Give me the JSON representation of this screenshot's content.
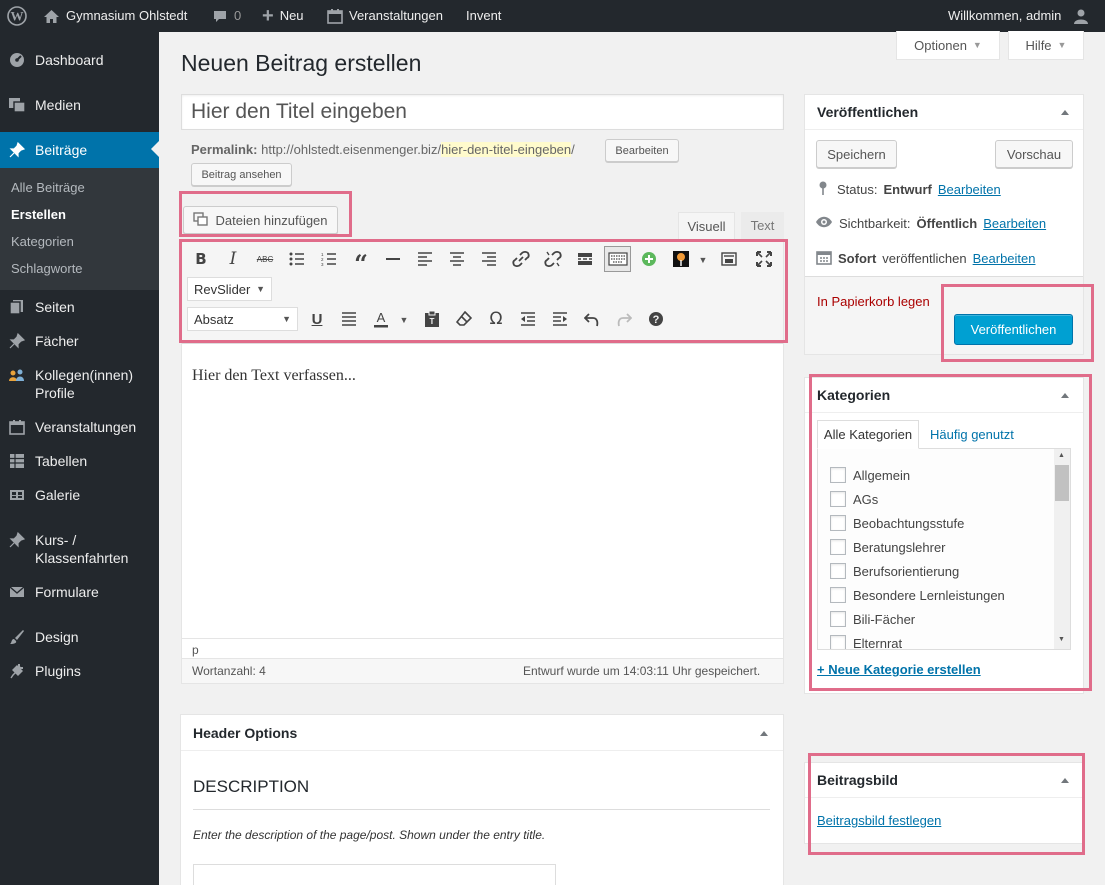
{
  "adminbar": {
    "site_name": "Gymnasium Ohlstedt",
    "comments_count": "0",
    "new_label": "Neu",
    "events_label": "Veranstaltungen",
    "invent_label": "Invent",
    "welcome": "Willkommen, admin"
  },
  "sidebar": {
    "items": [
      {
        "label": "Dashboard",
        "icon": "dashboard-icon"
      },
      {
        "label": "Medien",
        "icon": "media-icon"
      },
      {
        "label": "Beiträge",
        "icon": "pin-icon"
      },
      {
        "label": "Seiten",
        "icon": "pages-icon"
      },
      {
        "label": "Fächer",
        "icon": "pin-icon"
      },
      {
        "label": "Kollegen(innen)",
        "label2": "Profile",
        "icon": "people-icon"
      },
      {
        "label": "Veranstaltungen",
        "icon": "calendar-icon"
      },
      {
        "label": "Tabellen",
        "icon": "table-icon"
      },
      {
        "label": "Galerie",
        "icon": "gallery-icon"
      },
      {
        "label": "Kurs- /",
        "label2": "Klassenfahrten",
        "icon": "pin-icon"
      },
      {
        "label": "Formulare",
        "icon": "mail-icon"
      },
      {
        "label": "Design",
        "icon": "brush-icon"
      },
      {
        "label": "Plugins",
        "icon": "plug-icon"
      }
    ],
    "submenu": [
      "Alle Beiträge",
      "Erstellen",
      "Kategorien",
      "Schlagworte"
    ]
  },
  "screen_options": {
    "optionen": "Optionen",
    "hilfe": "Hilfe"
  },
  "page_title": "Neuen Beitrag erstellen",
  "title_input": {
    "placeholder": "Hier den Titel eingeben"
  },
  "permalink": {
    "label": "Permalink:",
    "base": "http://ohlstedt.eisenmenger.biz/",
    "slug": "hier-den-titel-eingeben",
    "trail": "/",
    "edit_button": "Bearbeiten",
    "view_button": "Beitrag ansehen"
  },
  "editor": {
    "add_media": "Dateien hinzufügen",
    "tab_visual": "Visuell",
    "tab_text": "Text",
    "revslider": "RevSlider",
    "format_select": "Absatz",
    "body_text": "Hier den Text verfassen...",
    "path": "p",
    "word_count": "Wortanzahl: 4",
    "saved_status": "Entwurf wurde um 14:03:11 Uhr gespeichert."
  },
  "header_options": {
    "title": "Header Options",
    "section": "DESCRIPTION",
    "help": "Enter the description of the page/post. Shown under the entry title."
  },
  "publish": {
    "title": "Veröffentlichen",
    "save_draft": "Speichern",
    "preview": "Vorschau",
    "status_label": "Status:",
    "status_value": "Entwurf",
    "visibility_label": "Sichtbarkeit:",
    "visibility_value": "Öffentlich",
    "schedule_label": "Sofort",
    "schedule_text": "veröffentlichen",
    "edit_link": "Bearbeiten",
    "trash": "In Papierkorb legen",
    "publish_button": "Veröffentlichen"
  },
  "categories": {
    "title": "Kategorien",
    "tab_all": "Alle Kategorien",
    "tab_popular": "Häufig genutzt",
    "items": [
      "Allgemein",
      "AGs",
      "Beobachtungsstufe",
      "Beratungslehrer",
      "Berufsorientierung",
      "Besondere Lernleistungen",
      "Bili-Fächer",
      "Elternrat"
    ],
    "add_new": "+ Neue Kategorie erstellen"
  },
  "featured_image": {
    "title": "Beitragsbild",
    "set_link": "Beitragsbild festlegen"
  },
  "colors": {
    "accent": "#0073aa",
    "publish_button": "#00a0d2",
    "highlight": "#e06c8a"
  }
}
